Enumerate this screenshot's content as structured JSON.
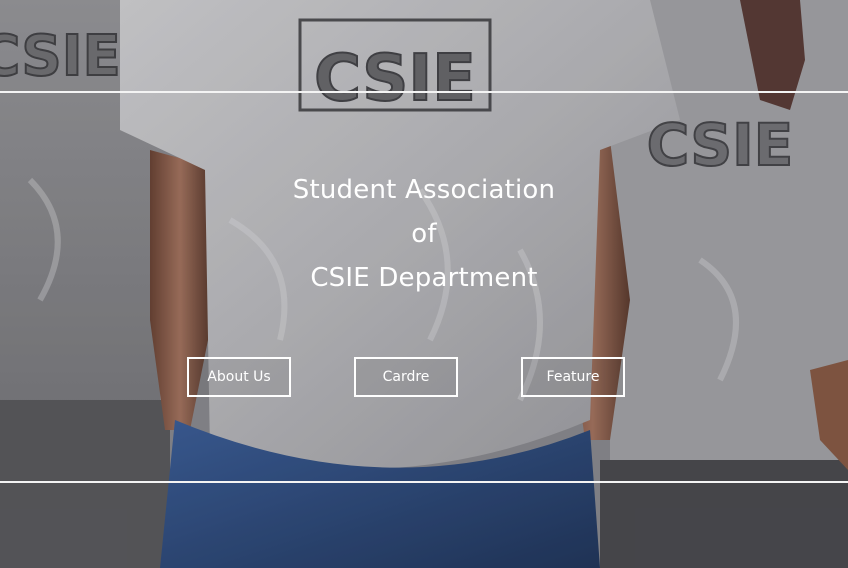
{
  "hero": {
    "title_lines": [
      "Student Association",
      "of",
      "CSIE Department"
    ]
  },
  "buttons": {
    "about": "About Us",
    "cardre": "Cardre",
    "feature": "Feature"
  },
  "background": {
    "shirt_print_text": "CSIE",
    "colors": {
      "shirt": "#c9c9cc",
      "skin": "#8a5b45",
      "jeans": "#2f4f86",
      "lines": "#f4f4f4"
    }
  }
}
